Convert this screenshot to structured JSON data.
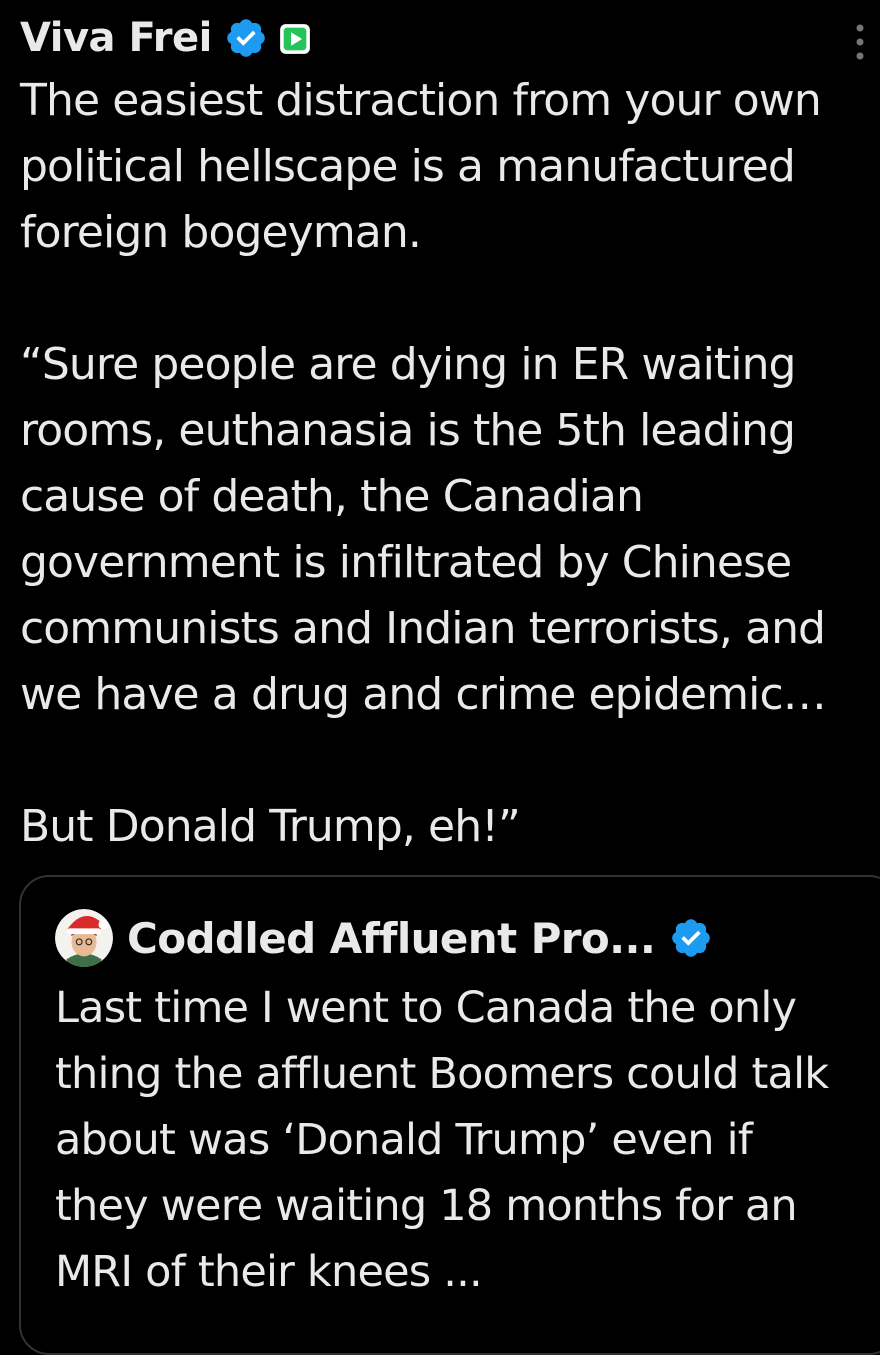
{
  "post": {
    "author": "Viva Frei",
    "text": "The easiest distraction from your own political hellscape is a manufactured foreign bogeyman.\n\n“Sure people are dying in ER waiting rooms, euthanasia is the 5th leading cause of death, the Canadian government is infiltrated by Chinese communists and Indian terrorists, and we have a drug and crime epidemic…\n\nBut Donald Trump, eh!”",
    "verified_icon": "verified-badge-icon",
    "extra_badge_icon": "play-badge-icon",
    "more_icon": "more-vertical-icon"
  },
  "quote": {
    "author": "Coddled Affluent Pro...",
    "text": "Last time I went to Canada the only thing the affluent Boomers could talk about was ‘Donald Trump’ even if they were waiting 18 months for an MRI of their knees ...",
    "verified_icon": "verified-badge-icon",
    "avatar_icon": "avatar"
  },
  "colors": {
    "background": "#000000",
    "text": "#e7e9ea",
    "verified_blue": "#1d9bf0",
    "play_green": "#26c35a",
    "border": "#2f3336"
  }
}
